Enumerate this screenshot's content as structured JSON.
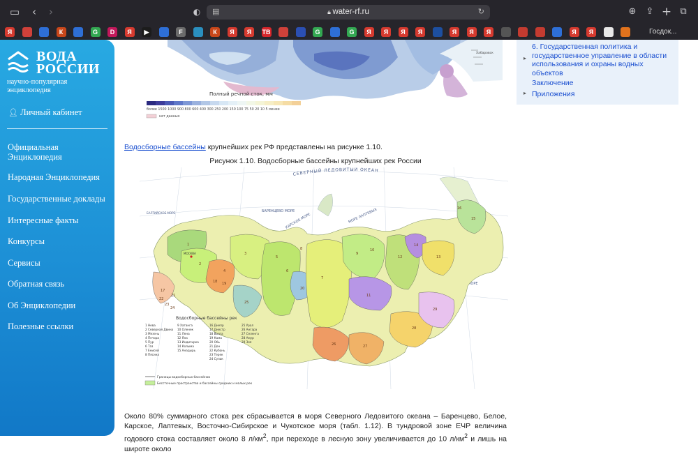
{
  "browser": {
    "url": "water-rf.ru",
    "favorites_last_label": "Госдок...",
    "favorites": [
      {
        "text": "Я",
        "color": "#d63a2f"
      },
      {
        "text": "",
        "color": "#d0413a"
      },
      {
        "text": "",
        "color": "#2e6fd6"
      },
      {
        "text": "К",
        "color": "#c9471a"
      },
      {
        "text": "",
        "color": "#2e6fd6"
      },
      {
        "text": "G",
        "color": "#33a852"
      },
      {
        "text": "D",
        "color": "#c2185b"
      },
      {
        "text": "Я",
        "color": "#d63a2f"
      },
      {
        "text": "▶",
        "color": "#1c1c1c"
      },
      {
        "text": "",
        "color": "#2e6fd6"
      },
      {
        "text": "F",
        "color": "#6b6b6b"
      },
      {
        "text": "",
        "color": "#2a8fbf"
      },
      {
        "text": "К",
        "color": "#c9471a"
      },
      {
        "text": "Я",
        "color": "#d63a2f"
      },
      {
        "text": "Я",
        "color": "#d63a2f"
      },
      {
        "text": "ТВ",
        "color": "#d7262b"
      },
      {
        "text": "",
        "color": "#d0413a"
      },
      {
        "text": "",
        "color": "#2b4fb3"
      },
      {
        "text": "G",
        "color": "#33a852"
      },
      {
        "text": "",
        "color": "#2e6fd6"
      },
      {
        "text": "G",
        "color": "#33a852"
      },
      {
        "text": "Я",
        "color": "#d63a2f"
      },
      {
        "text": "Я",
        "color": "#d63a2f"
      },
      {
        "text": "Я",
        "color": "#d63a2f"
      },
      {
        "text": "Я",
        "color": "#d63a2f"
      },
      {
        "text": "",
        "color": "#1d4fa0"
      },
      {
        "text": "Я",
        "color": "#d63a2f"
      },
      {
        "text": "Я",
        "color": "#d63a2f"
      },
      {
        "text": "Я",
        "color": "#d63a2f"
      },
      {
        "text": "",
        "color": "#555555"
      },
      {
        "text": "",
        "color": "#c43b30"
      },
      {
        "text": "",
        "color": "#c43b30"
      },
      {
        "text": "",
        "color": "#2e6fd6"
      },
      {
        "text": "Я",
        "color": "#d63a2f"
      },
      {
        "text": "Я",
        "color": "#d63a2f"
      },
      {
        "text": "",
        "color": "#e8e8e8"
      },
      {
        "text": "",
        "color": "#e2731d"
      }
    ]
  },
  "sidebar": {
    "logo_line1": "ВОДА",
    "logo_line2": "РОССИИ",
    "logo_sub": "научно-популярная энциклопедия",
    "cabinet": "Личный кабинет",
    "nav": [
      "Официальная Энциклопедия",
      "Народная Энциклопедия",
      "Государственные доклады",
      "Интересные факты",
      "Конкурсы",
      "Сервисы",
      "Обратная связь",
      "Об Энциклопедии",
      "Полезные ссылки"
    ]
  },
  "toc": {
    "items": [
      "6. Государственная политика и государственное управление в области использования и охраны водных объектов",
      "Заключение",
      "Приложения"
    ]
  },
  "map1": {
    "title": "Полный речной сток, мм",
    "scale": "более 1500 1000 900 800 600 400 300 250 200 150 100 75 50 20 10 5 менее",
    "nodata": "нет данных",
    "scale_colors": [
      "#2b2a80",
      "#3d3c9a",
      "#4b5ab5",
      "#5f78c9",
      "#7d97d6",
      "#9ab1de",
      "#b2c7e6",
      "#c7d9ef",
      "#d7e7f5",
      "#e4f0f7",
      "#eef6f4",
      "#f2f7e6",
      "#f4f4d6",
      "#f6eec6",
      "#f7e7b6",
      "#f5dca4",
      "#f3d098"
    ]
  },
  "content": {
    "intro_link": "Водосборные бассейны",
    "intro_rest": " крупнейших рек РФ представлены на рисунке 1.10.",
    "figure_caption": "Рисунок 1.10. Водосборные бассейны крупнейших рек России",
    "body_text_1": "Около 80% суммарного стока рек сбрасывается в моря Северного Ледовитого океана – Баренцево, Белое, Карское, Лаптевых, Восточно-Сибирское и Чукотское моря (табл. 1.12). В тундровой зоне ЕЧР величина годового стока составляет около 8 л/км",
    "body_text_2": ", при переходе в лесную зону увеличивается до 10 л/км",
    "body_text_3": " и лишь на широте около",
    "sup": "2"
  },
  "map2": {
    "ocean": "СЕВЕРНЫЙ ЛЕДОВИТЫЙ ОКЕАН",
    "sea_barents": "БАРЕНЦЕВО МОРЕ",
    "sea_kara": "КАРСКОЕ МОРЕ",
    "sea_laptev": "МОРЕ ЛАПТЕВЫХ",
    "sea_ochotsk": "ОХОТСКОЕ МОРЕ",
    "sea_baltic": "БАЛТИЙСКОЕ МОРЕ",
    "city": "МОСКВА",
    "legend_title": "Водосборные бассейны рек",
    "legend_col1": [
      "1 Нева",
      "2 Северная Двина",
      "3 Мезень",
      "4 Печора",
      "5 Пур",
      "6 Таз",
      "7 Енисей",
      "8 Пясина"
    ],
    "legend_col2": [
      "9 Хатанга",
      "10 Оленек",
      "11 Лена",
      "12 Яна",
      "13 Индигирка",
      "14 Колыма",
      "15 Анадырь"
    ],
    "legend_col3": [
      "16 Днепр",
      "17 Днестр",
      "18 Волга",
      "19 Кама",
      "20 Обь",
      "21 Дон",
      "22 Кубань",
      "23 Терек",
      "24 Сулак"
    ],
    "legend_col4": [
      "25 Урал",
      "26 Ангара",
      "27 Селенга",
      "28 Амур",
      "29 Зея"
    ],
    "legend_line1": "Границы водосборных бассейнов",
    "legend_line2": "Бессточные пространства и бассейны средних и малых рек",
    "region_numbers": [
      "1",
      "2",
      "3",
      "4",
      "5",
      "6",
      "7",
      "8",
      "9",
      "10",
      "11",
      "12",
      "13",
      "14",
      "15",
      "16",
      "17",
      "18",
      "19",
      "20",
      "21",
      "22",
      "23",
      "24",
      "25",
      "26",
      "27",
      "28",
      "29"
    ]
  }
}
